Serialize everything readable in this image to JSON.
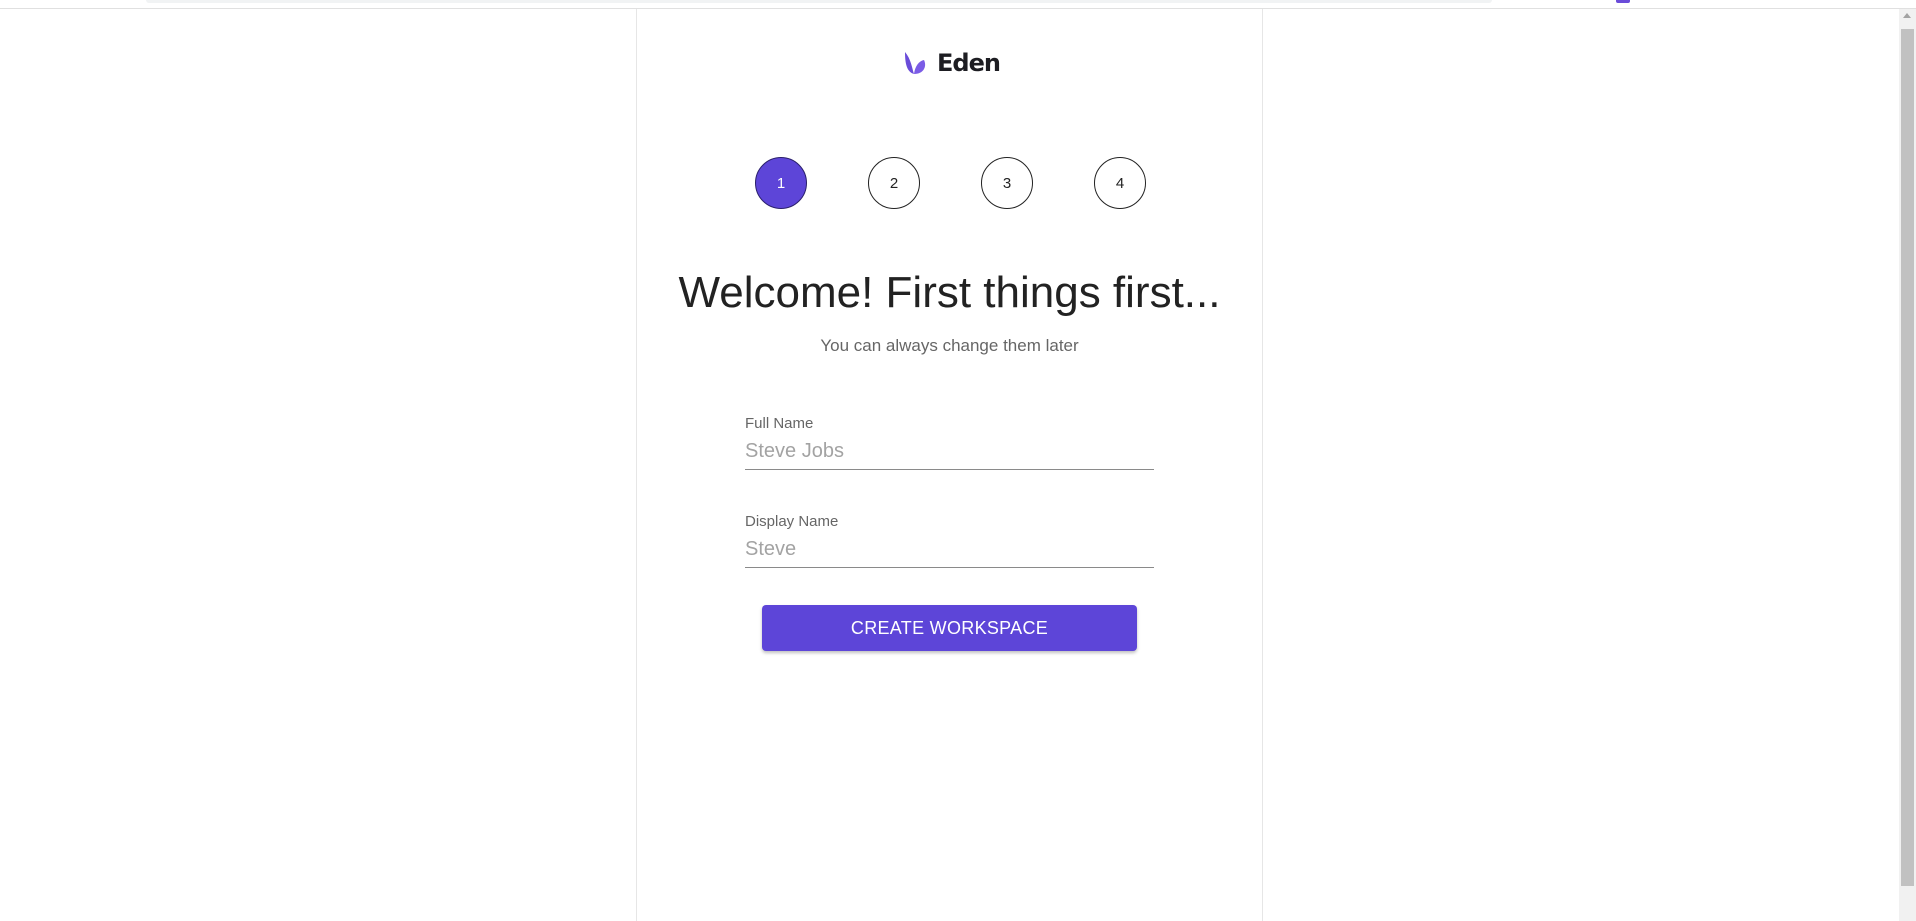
{
  "brand": {
    "name": "Eden",
    "icon": "eden-leaf-logo-icon",
    "color": "#6a4cd9"
  },
  "steps": [
    {
      "label": "1",
      "active": true
    },
    {
      "label": "2",
      "active": false
    },
    {
      "label": "3",
      "active": false
    },
    {
      "label": "4",
      "active": false
    }
  ],
  "heading": "Welcome! First things first...",
  "subheading": "You can always change them later",
  "form": {
    "full_name": {
      "label": "Full Name",
      "placeholder": "Steve Jobs",
      "value": ""
    },
    "display_name": {
      "label": "Display Name",
      "placeholder": "Steve",
      "value": ""
    },
    "submit_label": "CREATE WORKSPACE"
  },
  "colors": {
    "accent": "#5d45d8",
    "text": "#222222",
    "muted": "#666666"
  }
}
